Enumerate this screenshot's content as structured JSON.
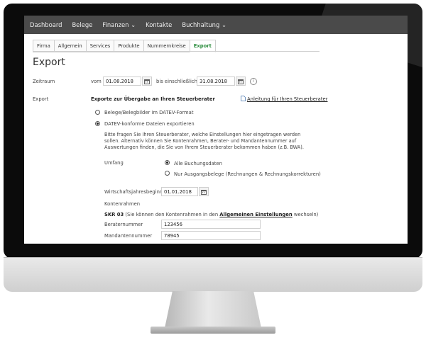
{
  "nav": [
    "Dashboard",
    "Belege",
    "Finanzen ⌄",
    "Kontakte",
    "Buchhaltung ⌄"
  ],
  "tabs": [
    "Firma",
    "Allgemein",
    "Services",
    "Produkte",
    "Nummernkreise",
    "Export"
  ],
  "active_tab": "Export",
  "page_title": "Export",
  "zeitraum": {
    "label": "Zeitraum",
    "from_label": "vom",
    "from_value": "01.08.2018",
    "to_label": "bis einschließlich",
    "to_value": "31.08.2018"
  },
  "export": {
    "label": "Export",
    "heading": "Exporte zur Übergabe an Ihren Steuerberater",
    "guide_link": "Anleitung für Ihren Steuerberater",
    "option_belege": "Belege/Belegbilder im DATEV-Format",
    "option_datev": "DATEV-konforme Dateien exportieren",
    "selected_option": "DATEV-konforme Dateien exportieren",
    "hint": "Bitte fragen Sie Ihren Steuerberater, welche Einstellungen hier eingetragen werden sollen. Alternativ können Sie Kontenrahmen, Berater- und Mandantennummer auf Auswertungen finden, die Sie von Ihrem Steuerberater bekommen haben (z.B. BWA)."
  },
  "umfang": {
    "label": "Umfang",
    "option_all": "Alle Buchungsdaten",
    "option_out": "Nur Ausgangsbelege (Rechnungen & Rechnungskorrekturen)",
    "selected": "Alle Buchungsdaten"
  },
  "wjb": {
    "label": "Wirtschaftsjahresbeginn",
    "value": "01.01.2018"
  },
  "kontenrahmen": {
    "label": "Kontenrahmen",
    "skr": "SKR 03",
    "text_before": "(Sie können den Kontenrahmen in den",
    "link": "Allgemeinen Einstellungen",
    "text_after": "wechseln)"
  },
  "beraternummer": {
    "label": "Beraternummer",
    "value": "123456"
  },
  "mandantennummer": {
    "label": "Mandantennummer",
    "value": "78945"
  }
}
